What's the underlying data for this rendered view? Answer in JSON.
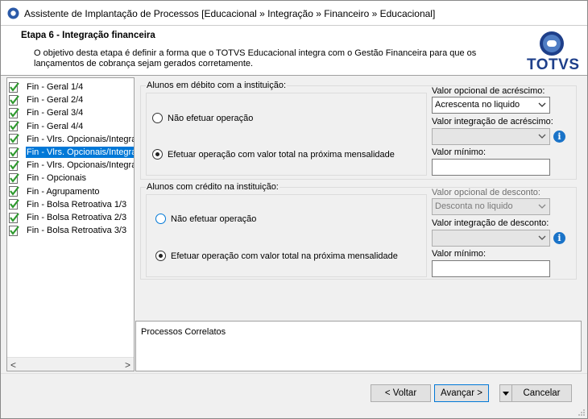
{
  "window": {
    "title": "Assistente de Implantação de Processos [Educacional » Integração » Financeiro » Educacional]"
  },
  "header": {
    "step_title": "Etapa 6 - Integração financeira",
    "description": "O objetivo desta etapa é definir a forma que o TOTVS Educacional integra com o Gestão Financeira para que os lançamentos de cobrança sejam gerados corretamente.",
    "logo_text": "TOTVS"
  },
  "tree": {
    "items": [
      {
        "label": "Fin - Geral 1/4",
        "selected": false
      },
      {
        "label": "Fin - Geral 2/4",
        "selected": false
      },
      {
        "label": "Fin - Geral 3/4",
        "selected": false
      },
      {
        "label": "Fin - Geral 4/4",
        "selected": false
      },
      {
        "label": "Fin - Vlrs. Opcionais/Integração",
        "selected": false
      },
      {
        "label": "Fin - Vlrs. Opcionais/Integração",
        "selected": true
      },
      {
        "label": "Fin - Vlrs. Opcionais/Integração",
        "selected": false
      },
      {
        "label": "Fin - Opcionais",
        "selected": false
      },
      {
        "label": "Fin - Agrupamento",
        "selected": false
      },
      {
        "label": "Fin - Bolsa Retroativa 1/3",
        "selected": false
      },
      {
        "label": "Fin - Bolsa Retroativa 2/3",
        "selected": false
      },
      {
        "label": "Fin - Bolsa Retroativa 3/3",
        "selected": false
      }
    ],
    "scroll_left": "<",
    "scroll_right": ">"
  },
  "debito": {
    "legend": "Alunos em débito com a instituição:",
    "option_none": "Não efetuar operação",
    "option_total": "Efetuar operação com valor total na próxima mensalidade",
    "selected": "option_total",
    "acrescimo_label": "Valor opcional de acréscimo:",
    "acrescimo_value": "Acrescenta no liquido",
    "integracao_label": "Valor integração de acréscimo:",
    "integracao_value": "",
    "minimo_label": "Valor mínimo:",
    "minimo_value": ""
  },
  "credito": {
    "legend": "Alunos com crédito na instituição:",
    "option_none": "Não efetuar operação",
    "option_total": "Efetuar operação com valor total na próxima mensalidade",
    "selected": "option_total",
    "desconto_label": "Valor opcional de desconto:",
    "desconto_value": "Desconta no liquido",
    "integracao_label": "Valor integração de desconto:",
    "integracao_value": "",
    "minimo_label": "Valor mínimo:",
    "minimo_value": ""
  },
  "correlatos": {
    "label": "Processos Correlatos"
  },
  "footer": {
    "back_label": "< Voltar",
    "next_label": "Avançar >",
    "cancel_label": "Cancelar"
  },
  "colors": {
    "selection": "#0078d7",
    "info_icon": "#1a73c8",
    "logo": "#1e3f8a"
  }
}
